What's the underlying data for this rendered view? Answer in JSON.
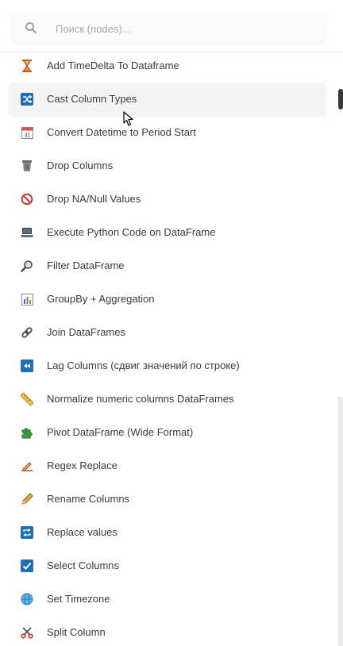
{
  "search": {
    "placeholder": "Поиск (nodes)..."
  },
  "nodes": [
    {
      "label": "Add TimeDelta To Dataframe",
      "icon": "hourglass-icon"
    },
    {
      "label": "Cast Column Types",
      "icon": "shuffle-icon"
    },
    {
      "label": "Convert Datetime to Period Start",
      "icon": "calendar-icon"
    },
    {
      "label": "Drop Columns",
      "icon": "trash-icon"
    },
    {
      "label": "Drop NA/Null Values",
      "icon": "prohibited-icon"
    },
    {
      "label": "Execute Python Code on DataFrame",
      "icon": "laptop-icon"
    },
    {
      "label": "Filter DataFrame",
      "icon": "magnifier-icon"
    },
    {
      "label": "GroupBy + Aggregation",
      "icon": "bar-chart-icon"
    },
    {
      "label": "Join DataFrames",
      "icon": "link-icon"
    },
    {
      "label": "Lag Columns (сдвиг значений по строке)",
      "icon": "rewind-icon"
    },
    {
      "label": "Normalize numeric columns DataFrames",
      "icon": "ruler-icon"
    },
    {
      "label": "Pivot DataFrame (Wide Format)",
      "icon": "puzzle-icon"
    },
    {
      "label": "Regex Replace",
      "icon": "pen-icon"
    },
    {
      "label": "Rename Columns",
      "icon": "pencil-icon"
    },
    {
      "label": "Replace values",
      "icon": "repeat-icon"
    },
    {
      "label": "Select Columns",
      "icon": "check-box-icon"
    },
    {
      "label": "Set Timezone",
      "icon": "globe-icon"
    },
    {
      "label": "Split Column",
      "icon": "scissors-icon"
    }
  ],
  "hovered_item": "Cast Column Types",
  "colors": {
    "label": "#3b3b3b",
    "placeholder": "#a7a7a7",
    "hover_bg": "#f4f4f4",
    "icon_blue": "#1f6fb2"
  }
}
